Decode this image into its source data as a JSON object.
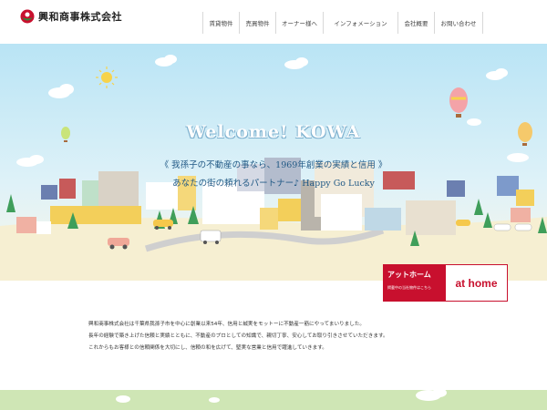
{
  "brand": {
    "name": "興和商事株式会社",
    "accent": "#c8102e"
  },
  "nav": {
    "items": [
      {
        "label": "賃貸物件"
      },
      {
        "label": "売買物件"
      },
      {
        "label": "オーナー様へ"
      },
      {
        "label": "インフォメーション"
      },
      {
        "label": "会社概要"
      },
      {
        "label": "お問い合わせ"
      }
    ]
  },
  "hero": {
    "welcome": "Welcome! KOWA",
    "tagline1": "《 我孫子の不動産の事なら、1969年創業の実績と信用 》",
    "tagline2": "あなたの街の頼れるパートナー♪ Happy Go Lucky"
  },
  "athome": {
    "jp_label": "アットホーム",
    "sub_label": "掲載中の当社物件はこちら",
    "logo_text": "at home"
  },
  "intro": {
    "lines": [
      "興和商事株式会社は千葉県我孫子市を中心に創業以来54年、信用と誠実をモットーに不動産一筋にやってまいりました。",
      "長年の経験で築き上げた信頼と実績とともに、不動産のプロとしての知識で、親切丁寧、安心してお取り引きさせていただきます。",
      "これからもお客様との信頼関係を大切にし、信頼の和を広げて、堅実な営業と信用で躍進していきます。"
    ]
  }
}
